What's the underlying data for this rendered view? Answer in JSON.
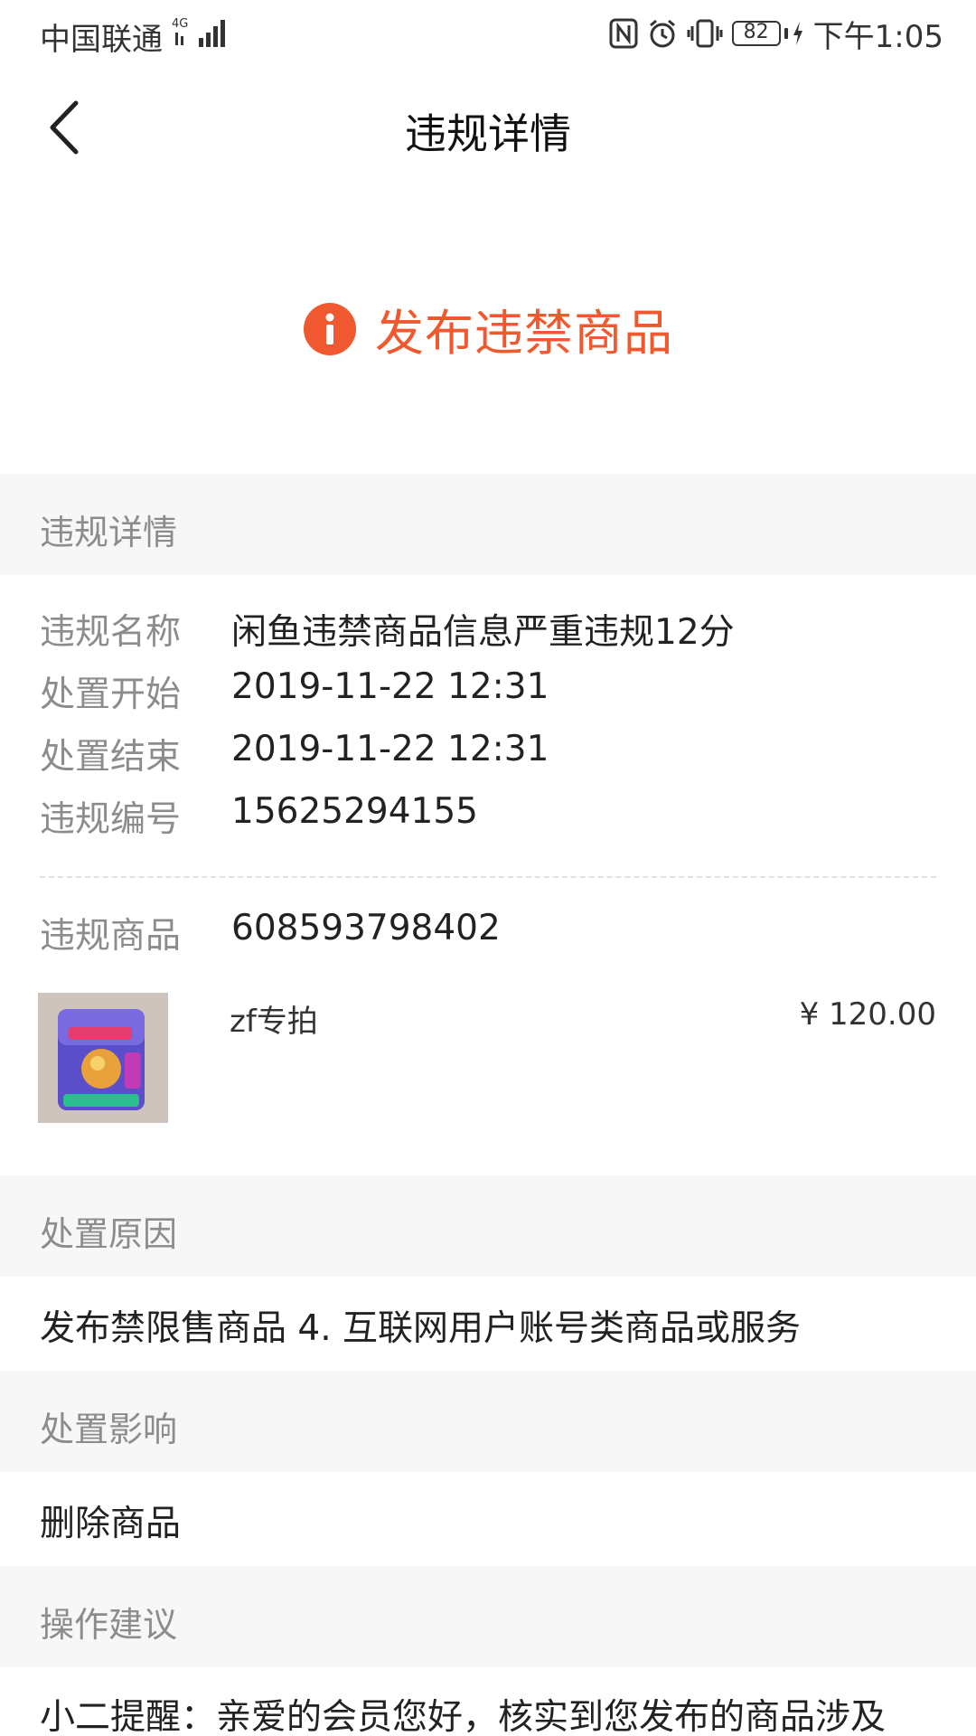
{
  "status_bar": {
    "carrier": "中国联通",
    "network": "4G",
    "battery": "82",
    "time": "下午1:05"
  },
  "nav": {
    "title": "违规详情"
  },
  "banner": {
    "warning_text": "发布违禁商品",
    "accent_color": "#f0582f"
  },
  "details_section": {
    "header": "违规详情",
    "rows": [
      {
        "key": "违规名称",
        "value": "闲鱼违禁商品信息严重违规12分"
      },
      {
        "key": "处置开始",
        "value": "2019-11-22 12:31"
      },
      {
        "key": "处置结束",
        "value": "2019-11-22 12:31"
      },
      {
        "key": "违规编号",
        "value": "15625294155"
      }
    ],
    "item_label": "违规商品",
    "item_id": "608593798402",
    "product": {
      "name": "zf专拍",
      "price": "¥ 120.00"
    }
  },
  "reason_section": {
    "header": "处置原因",
    "text": "发布禁限售商品 4. 互联网用户账号类商品或服务"
  },
  "impact_section": {
    "header": "处置影响",
    "text": "删除商品"
  },
  "advice_section": {
    "header": "操作建议",
    "text": "小二提醒：亲爱的会员您好，核实到您发布的商品涉及"
  }
}
